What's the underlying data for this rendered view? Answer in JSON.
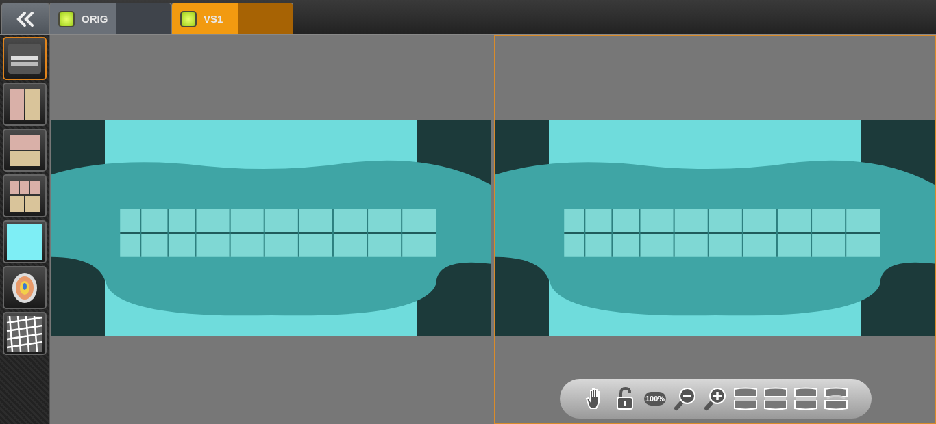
{
  "tabs": [
    {
      "label": "ORIG",
      "selected": false
    },
    {
      "label": "VS1",
      "selected": true
    }
  ],
  "sidebar": {
    "tools": [
      {
        "kind": "teeth",
        "selected": true
      },
      {
        "kind": "split-columns",
        "selected": false
      },
      {
        "kind": "split-rows",
        "selected": false
      },
      {
        "kind": "split-grid",
        "selected": false
      },
      {
        "kind": "plain",
        "selected": false
      },
      {
        "kind": "heatmap",
        "selected": false
      },
      {
        "kind": "mesh",
        "selected": false
      }
    ]
  },
  "viewports": [
    {
      "selected": false
    },
    {
      "selected": true
    }
  ],
  "toolbar": {
    "items": [
      {
        "kind": "hand"
      },
      {
        "kind": "lock"
      },
      {
        "kind": "zoom-reset",
        "label": "100%"
      },
      {
        "kind": "zoom-out"
      },
      {
        "kind": "zoom-in"
      },
      {
        "kind": "jaw-front"
      },
      {
        "kind": "jaw-closed"
      },
      {
        "kind": "jaw-side"
      },
      {
        "kind": "jaw-open"
      }
    ]
  }
}
